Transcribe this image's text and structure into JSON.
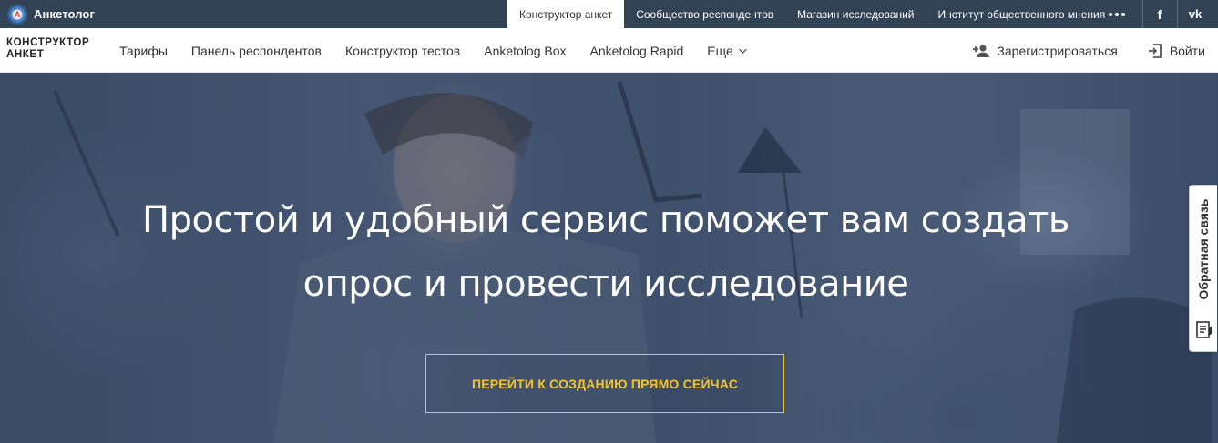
{
  "topbar": {
    "brand": "Анкетолог",
    "tabs": [
      {
        "label": "Конструктор анкет",
        "active": true
      },
      {
        "label": "Сообщество респондентов",
        "active": false
      },
      {
        "label": "Магазин исследований",
        "active": false
      },
      {
        "label": "Институт общественного мнения",
        "active": false
      }
    ],
    "more_icon": "more-dots-icon",
    "social": {
      "facebook": "f",
      "vk": "vk"
    }
  },
  "nav": {
    "logo_line1": "КОНСТРУКТОР",
    "logo_line2": "АНКЕТ",
    "items": [
      "Тарифы",
      "Панель респондентов",
      "Конструктор тестов",
      "Anketolog Box",
      "Anketolog Rapid",
      "Еще"
    ],
    "register": "Зарегистрироваться",
    "login": "Войти"
  },
  "hero": {
    "title_line1": "Простой и удобный сервис поможет вам создать",
    "title_line2": "опрос и провести исследование",
    "cta": "ПЕРЕЙТИ К СОЗДАНИЮ ПРЯМО СЕЙЧАС"
  },
  "feedback": {
    "label": "Обратная связь"
  },
  "colors": {
    "topbar": "#324355",
    "cta": "#f4c430",
    "overlay": "#263758"
  }
}
